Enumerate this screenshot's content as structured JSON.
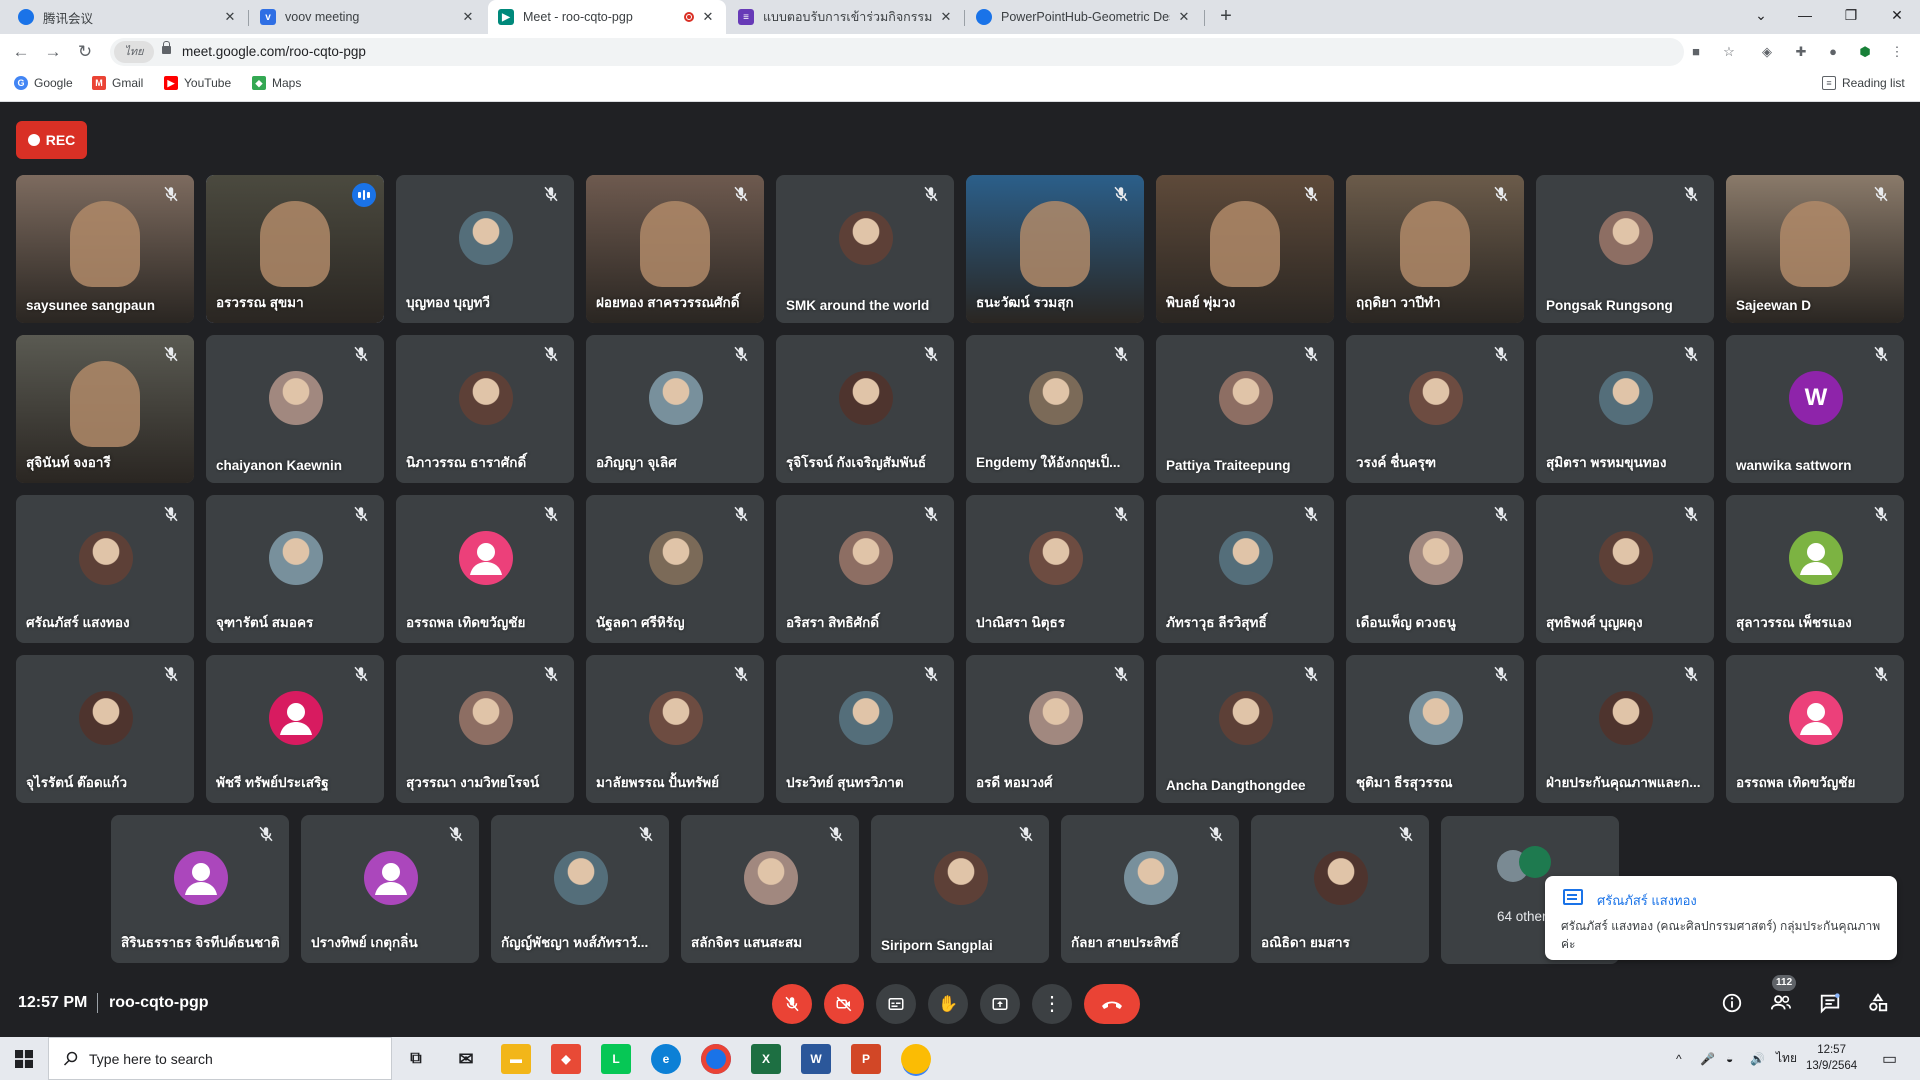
{
  "browser": {
    "tabs": [
      {
        "title": "腾讯会议",
        "favicon": "chrome-icon",
        "color": "#1a73e8",
        "active": false
      },
      {
        "title": "voov meeting",
        "favicon": "voov-icon",
        "color": "#2f6fe4",
        "active": false
      },
      {
        "title": "Meet - roo-cqto-pgp",
        "favicon": "meet-icon",
        "color": "#00897b",
        "active": true,
        "recording": true
      },
      {
        "title": "แบบตอบรับการเข้าร่วมกิจกรรม KM SS",
        "favicon": "forms-icon",
        "color": "#673ab7",
        "active": false
      },
      {
        "title": "PowerPointHub-Geometric Desig",
        "favicon": "chrome-icon",
        "color": "#1a73e8",
        "active": false
      }
    ],
    "url": "meet.google.com/roo-cqto-pgp",
    "language_chip": "ไทย",
    "bookmarks": [
      "Google",
      "Gmail",
      "YouTube",
      "Maps"
    ],
    "reading_list": "Reading list"
  },
  "meeting": {
    "rec_label": "REC",
    "time": "12:57 PM",
    "code": "roo-cqto-pgp",
    "participant_count": "112",
    "others_label": "64 others",
    "rows": [
      [
        "saysunee sangpaun",
        "อรวรรณ สุขมา",
        "บุญทอง บุญทวี",
        "ฝอยทอง สาครวรรณศักดิ์",
        "SMK around the world",
        "ธนะวัฒน์ รวมสุก",
        "พิบลย์ พุ่มวง",
        "ฤฤดิยา วาปีทำ",
        "Pongsak Rungsong",
        "Sajeewan D"
      ],
      [
        "สุจินันท์ จงอารี",
        "chaiyanon Kaewnin",
        "นิภาวรรณ ธาราศักดิ์",
        "อภิญญา จุเลิศ",
        "รุจิโรจน์ กังเจริญสัมพันธ์",
        "Engdemy ให้อังกฤษเป็...",
        "Pattiya Traiteepung",
        "วรงค์ ชื่นครุฑ",
        "สุมิตรา พรหมขุนทอง",
        "wanwika sattworn"
      ],
      [
        "ศรัณภัสร์ แสงทอง",
        "จุฑารัตน์ สมอคร",
        "อรรถพล เทิดขวัญชัย",
        "นัฐลดา ศรีหิรัญ",
        "อริสรา สิทธิศักดิ์",
        "ปาณิสรา นิตุธร",
        "ภัทราวุธ ลีรวิสุทธิ์",
        "เดือนเพ็ญ ดวงธนู",
        "สุทธิพงศ์ บุญผดุง",
        "สุลาวรรณ เพ็ชรแอง"
      ],
      [
        "จุไรรัตน์ ต๊อดแก้ว",
        "พัชรี ทรัพย์ประเสริฐ",
        "สุวรรณา งามวิทยโรจน์",
        "มาลัยพรรณ ปั้นทรัพย์",
        "ประวิทย์ สุนทรวิภาต",
        "อรดี หอมวงศ์",
        "Ancha Dangthongdee",
        "ชุติมา ธีรสุวรรณ",
        "ฝ่ายประกันคุณภาพและก...",
        "อรรถพล เทิดขวัญชัย"
      ],
      [
        "สิรินธรราธร จิรทีปต์ธนชาติ",
        "ปรางทิพย์ เกตุกลิ่น",
        "กัญญ์พัชญา หงส์ภัทราวั...",
        "สลักจิตร แสนสะสม",
        "Siriporn Sangplai",
        "กัลยา สายประสิทธิ์",
        "อณิธิดา ยมสาร"
      ]
    ],
    "toast": {
      "sender": "ศรัณภัสร์ แสงทอง",
      "message": "ศรัณภัสร์ แสงทอง (คณะศิลปกรรมศาสตร์) กลุ่มประกันคุณภาพค่ะ"
    }
  },
  "taskbar": {
    "search_placeholder": "Type here to search",
    "input_language": "ไทย",
    "time": "12:57",
    "date": "13/9/2564"
  },
  "colors": {
    "meet_bg": "#202124",
    "tile_bg": "#3c4043",
    "rec_red": "#d93025",
    "end_red": "#ea4335",
    "active_ring": "#8ab4f8"
  }
}
